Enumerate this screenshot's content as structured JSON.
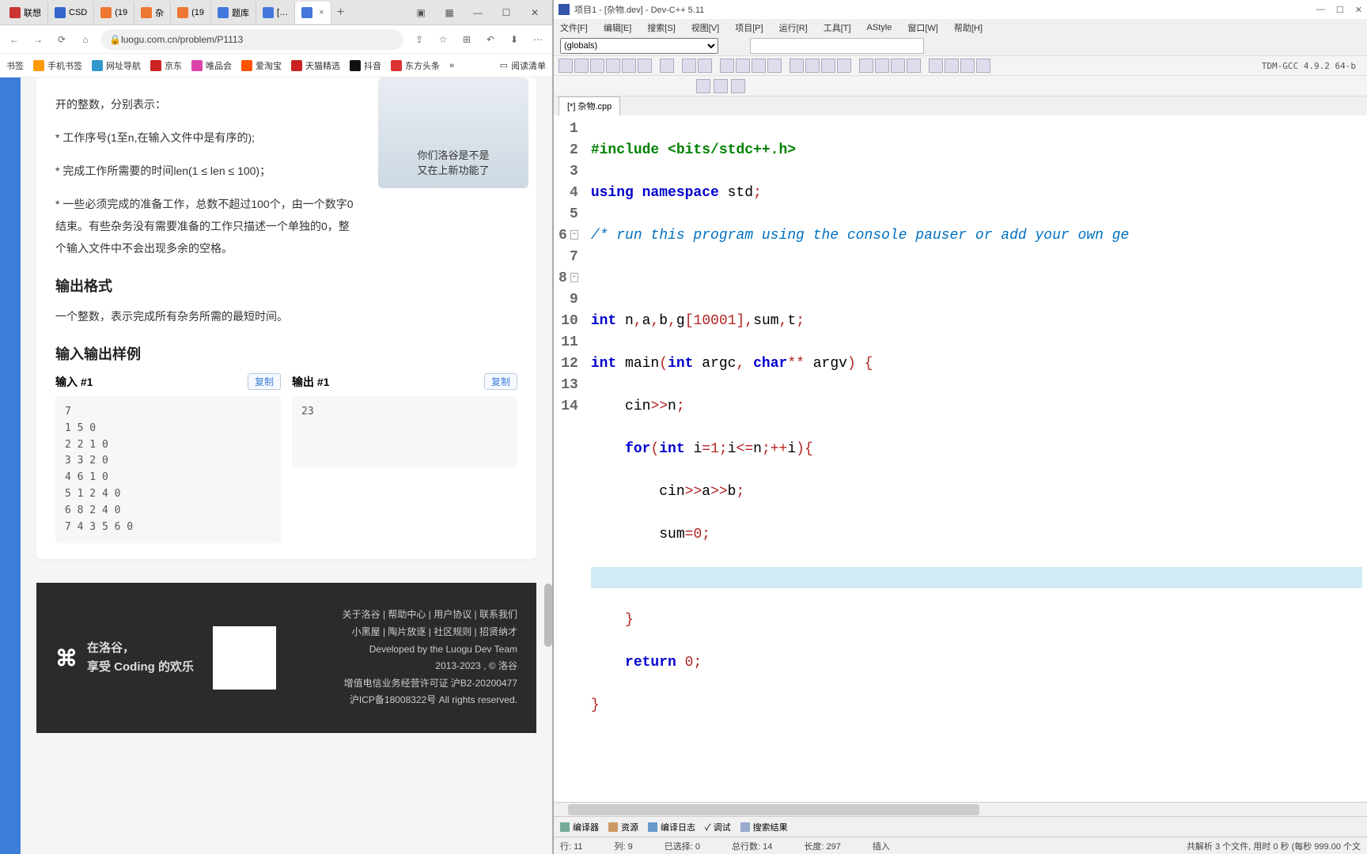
{
  "browser": {
    "tabs": [
      {
        "label": "联想"
      },
      {
        "label": "CSD"
      },
      {
        "label": "(19"
      },
      {
        "label": "杂"
      },
      {
        "label": "(19"
      },
      {
        "label": "题库"
      },
      {
        "label": "[…"
      },
      {
        "label": ""
      }
    ],
    "url": "luogu.com.cn/problem/P1113",
    "bookmarks": [
      "书签",
      "手机书签",
      "网址导航",
      "京东",
      "唯品会",
      "爱淘宝",
      "天猫精选",
      "抖音",
      "东方头条"
    ],
    "read_list": "阅读清单"
  },
  "problem": {
    "p0": "开的整数，分别表示：",
    "p1": "* 工作序号(1至n,在输入文件中是有序的);",
    "p2": "* 完成工作所需要的时间len(1 ≤ len ≤ 100)；",
    "p3": "* 一些必须完成的准备工作，总数不超过100个，由一个数字0结束。有些杂务没有需要准备的工作只描述一个单独的0，整个输入文件中不会出现多余的空格。",
    "h_out": "输出格式",
    "p_out": "一个整数，表示完成所有杂务所需的最短时间。",
    "h_sample": "输入输出样例",
    "in_label": "输入 #1",
    "out_label": "输出 #1",
    "copy": "复制",
    "input": "7\n1 5 0\n2 2 1 0\n3 3 2 0\n4 6 1 0\n5 1 2 4 0\n6 8 2 4 0\n7 4 3 5 6 0",
    "output": "23",
    "promo1": "你们洛谷是不是",
    "promo2": "又在上新功能了"
  },
  "footer": {
    "slogan1": "在洛谷，",
    "slogan2": "享受 Coding 的欢乐",
    "links1": "关于洛谷 | 帮助中心 | 用户协议 | 联系我们",
    "links2": "小黑屋 | 陶片放逐 | 社区规则 | 招贤纳才",
    "dev": "Developed by the Luogu Dev Team",
    "year": "2013-2023 , © 洛谷",
    "icp1": "增值电信业务经营许可证 沪B2-20200477",
    "icp2": "沪ICP备18008322号 All rights reserved."
  },
  "devcpp": {
    "title": "项目1 - [杂物.dev] - Dev-C++ 5.11",
    "menus": [
      "文件[F]",
      "编辑[E]",
      "搜索[S]",
      "视图[V]",
      "项目[P]",
      "运行[R]",
      "工具[T]",
      "AStyle",
      "窗口[W]",
      "帮助[H]"
    ],
    "globals": "(globals)",
    "compiler": "TDM-GCC 4.9.2 64-b",
    "file_tab": "[*] 杂物.cpp",
    "bottom_tabs": [
      "编译器",
      "资源",
      "编译日志",
      "✓ 调试",
      "搜索结果"
    ],
    "status": {
      "line": "行:   11",
      "col": "列:   9",
      "sel": "已选择:   0",
      "total": "总行数:   14",
      "len": "长度:   297",
      "mode": "插入",
      "parse": "共解析 3 个文件, 用时 0 秒 (每秒 999.00 个文"
    }
  },
  "code": {
    "l1a": "#include ",
    "l1b": "<bits/stdc++.h>",
    "l2a": "using ",
    "l2b": "namespace ",
    "l2c": "std",
    "l2d": ";",
    "l3": "/* run this program using the console pauser or add your own ge",
    "l5a": "int ",
    "l5b": "n",
    "l5c": ",",
    "l5d": "a",
    "l5e": ",",
    "l5f": "b",
    "l5g": ",",
    "l5h": "g",
    "l5i": "[",
    "l5j": "10001",
    "l5k": "],",
    "l5l": "sum",
    "l5m": ",",
    "l5n": "t",
    "l5o": ";",
    "l6a": "int ",
    "l6b": "main",
    "l6c": "(",
    "l6d": "int ",
    "l6e": "argc",
    "l6f": ", ",
    "l6g": "char",
    "l6h": "** ",
    "l6i": "argv",
    "l6j": ") {",
    "l7a": "cin",
    "l7b": ">>",
    "l7c": "n",
    "l7d": ";",
    "l8a": "for",
    "l8b": "(",
    "l8c": "int ",
    "l8d": "i",
    "l8e": "=",
    "l8f": "1",
    "l8g": ";",
    "l8h": "i",
    "l8i": "<=",
    "l8j": "n",
    "l8k": ";++",
    "l8l": "i",
    "l8m": "){",
    "l9a": "cin",
    "l9b": ">>",
    "l9c": "a",
    "l9d": ">>",
    "l9e": "b",
    "l9f": ";",
    "l10a": "sum",
    "l10b": "=",
    "l10c": "0",
    "l10d": ";",
    "l12": "}",
    "l13a": "return ",
    "l13b": "0",
    "l13c": ";",
    "l14": "}"
  }
}
